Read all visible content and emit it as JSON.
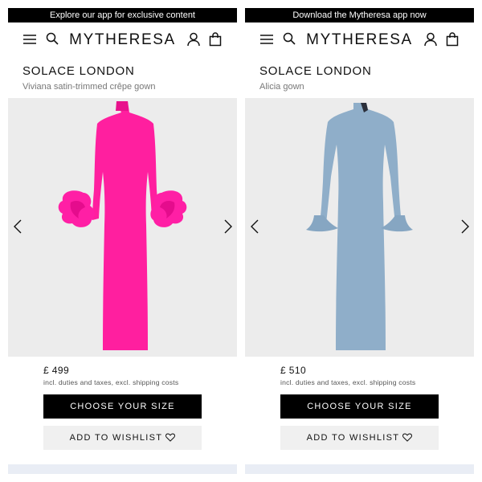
{
  "colors": {
    "promo_bg": "#000000",
    "primary_button_bg": "#000000",
    "secondary_button_bg": "#f0f0f0",
    "gallery_bg": "#ececec",
    "dress_left": "#ff1f9f",
    "dress_right": "#8faec9"
  },
  "icons": [
    "hamburger-menu-icon",
    "search-icon",
    "account-icon",
    "shopping-bag-icon",
    "chevron-left-icon",
    "chevron-right-icon",
    "heart-icon"
  ],
  "panels": [
    {
      "promo_text": "Explore our app for exclusive content",
      "logo": "MYTHERESA",
      "brand": "SOLACE LONDON",
      "product_name": "Viviana satin-trimmed crêpe gown",
      "price": "£ 499",
      "tax_note": "incl. duties and taxes, excl. shipping costs",
      "choose_size_label": "CHOOSE YOUR SIZE",
      "wishlist_label": "ADD TO WISHLIST"
    },
    {
      "promo_text": "Download the Mytheresa app now",
      "logo": "MYTHERESA",
      "brand": "SOLACE LONDON",
      "product_name": "Alicia gown",
      "price": "£ 510",
      "tax_note": "incl. duties and taxes, excl. shipping costs",
      "choose_size_label": "CHOOSE YOUR SIZE",
      "wishlist_label": "ADD TO WISHLIST"
    }
  ]
}
